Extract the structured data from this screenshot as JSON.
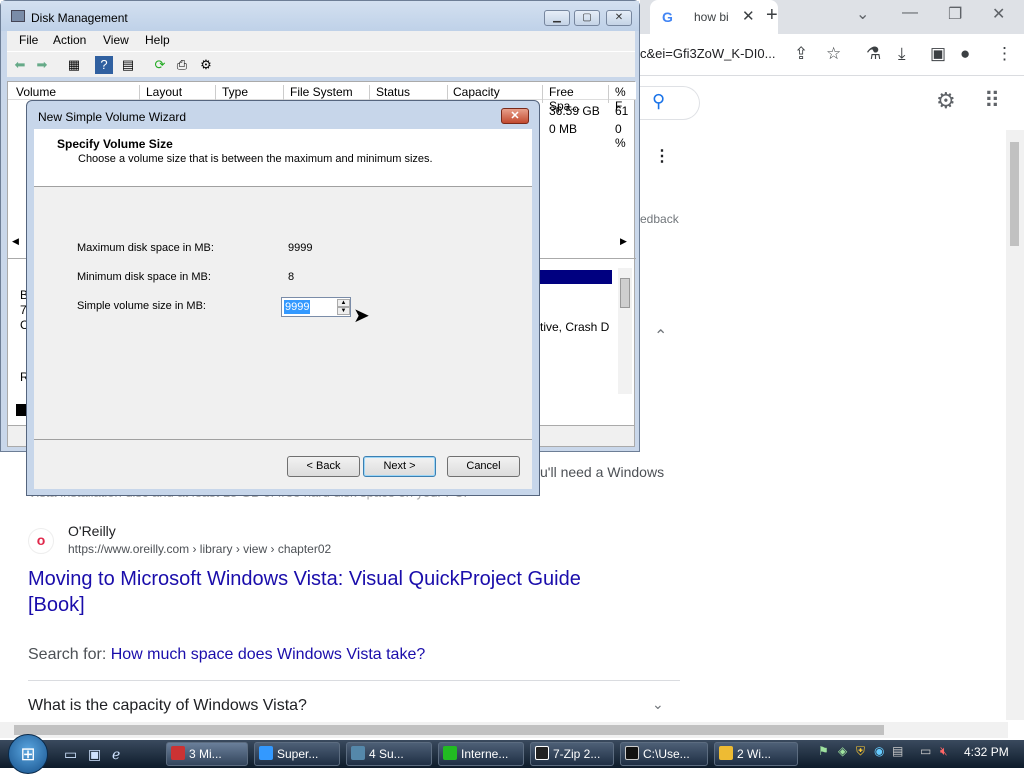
{
  "browser": {
    "tab_title": "how bi",
    "tab_icon": "G",
    "url_fragment": "c&ei=Gfi3ZoW_K-DI0...",
    "feedback": "edback",
    "snippet_line1": "u'll need a Windows",
    "snippet_line2": "Vista installation disc and at least 15 GB of free hard disk space on your PC.",
    "source_name": "O'Reilly",
    "source_url": "https://www.oreilly.com › library › view › chapter02",
    "result_title": "Moving to Microsoft Windows Vista: Visual QuickProject Guide [Book]",
    "search_for_label": "Search for:",
    "search_for_link": "How much space does Windows Vista take?",
    "paa_question": "What is the capacity of Windows Vista?"
  },
  "disk_mgmt": {
    "title": "Disk Management",
    "menu": [
      "File",
      "Action",
      "View",
      "Help"
    ],
    "columns": [
      "Volume",
      "Layout",
      "Type",
      "File System",
      "Status",
      "Capacity",
      "Free Spa...",
      "% F"
    ],
    "rows": [
      {
        "free": "36.59 GB",
        "pct": "61"
      },
      {
        "free": "0 MB",
        "pct": "0 %"
      }
    ],
    "graph_text": "tive, Crash D",
    "left_letters": [
      "B",
      "7",
      "C",
      "R"
    ]
  },
  "wizard": {
    "title": "New Simple Volume Wizard",
    "heading": "Specify Volume Size",
    "subheading": "Choose a volume size that is between the maximum and minimum sizes.",
    "max_label": "Maximum disk space in MB:",
    "max_value": "9999",
    "min_label": "Minimum disk space in MB:",
    "min_value": "8",
    "size_label": "Simple volume size in MB:",
    "size_value": "9999",
    "back": "< Back",
    "next": "Next >",
    "cancel": "Cancel"
  },
  "taskbar": {
    "items": [
      "3 Mi...",
      "Super...",
      "4 Su...",
      "Interne...",
      "7-Zip 2...",
      "C:\\Use...",
      "2 Wi..."
    ],
    "clock": "4:32 PM"
  },
  "colors": {
    "link": "#1a0dab",
    "aero": "#c7d6ea",
    "taskbar": "#0d1b2a"
  }
}
